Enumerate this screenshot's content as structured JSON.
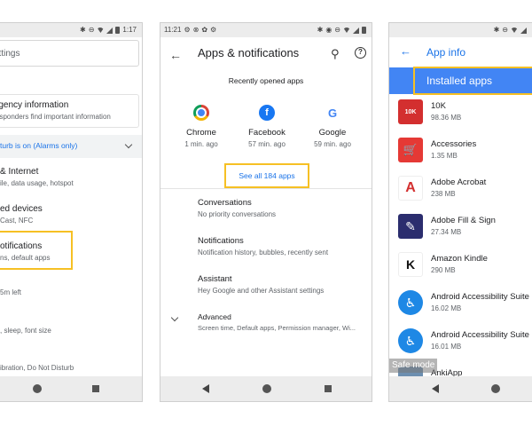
{
  "colors": {
    "accent": "#1a73e8",
    "highlight": "#f6c024",
    "banner": "#4285f4"
  },
  "phone1": {
    "search_placeholder": "ettings",
    "emergency": {
      "title": "rgency information",
      "subtitle": "esponders find important information"
    },
    "dnd_text": "turb is on (Alarms only)",
    "items": [
      {
        "title": "& Internet",
        "subtitle": "ile, data usage, hotspot"
      },
      {
        "title": "ed devices",
        "subtitle": "Cast, NFC"
      },
      {
        "title": "otifications",
        "subtitle": "ns, default apps"
      },
      {
        "title": "",
        "subtitle": "5m left"
      },
      {
        "title": "",
        "subtitle": ", sleep, font size"
      },
      {
        "title": "",
        "subtitle": "ibration, Do Not Disturb"
      }
    ],
    "status_time": "1:17"
  },
  "phone2": {
    "status_time": "11:21",
    "title": "Apps & notifications",
    "recent_title": "Recently opened apps",
    "apps": [
      {
        "name": "Chrome",
        "time": "1 min. ago",
        "icon": "chrome-icon"
      },
      {
        "name": "Facebook",
        "time": "57 min. ago",
        "icon": "facebook-icon",
        "glyph": "f"
      },
      {
        "name": "Google",
        "time": "59 min. ago",
        "icon": "google-icon",
        "glyph": "G"
      }
    ],
    "see_all": "See all 184 apps",
    "items": [
      {
        "title": "Conversations",
        "subtitle": "No priority conversations"
      },
      {
        "title": "Notifications",
        "subtitle": "Notification history, bubbles, recently sent"
      },
      {
        "title": "Assistant",
        "subtitle": "Hey Google and other Assistant settings"
      },
      {
        "title": "Advanced",
        "subtitle": "Screen time, Default apps, Permission manager, Wi..."
      }
    ]
  },
  "phone3": {
    "title": "App info",
    "banner": "Installed apps",
    "apps": [
      {
        "name": "10K",
        "size": "98.36 MB",
        "color": "#d32f2f",
        "glyph": "10K"
      },
      {
        "name": "Accessories",
        "size": "1.35 MB",
        "color": "#e53935",
        "glyph": "🛒"
      },
      {
        "name": "Adobe Acrobat",
        "size": "238 MB",
        "color": "#ffffff",
        "glyph": "A"
      },
      {
        "name": "Adobe Fill & Sign",
        "size": "27.34 MB",
        "color": "#2b2d6e",
        "glyph": "✎"
      },
      {
        "name": "Amazon Kindle",
        "size": "290 MB",
        "color": "#ffffff",
        "glyph": "K"
      },
      {
        "name": "Android Accessibility Suite",
        "size": "16.02 MB",
        "color": "#1e88e5",
        "glyph": "♿"
      },
      {
        "name": "Android Accessibility Suite",
        "size": "16.01 MB",
        "color": "#1e88e5",
        "glyph": "♿"
      },
      {
        "name": "AnkiApp",
        "size": "",
        "color": "#6d8fb0",
        "glyph": ""
      }
    ],
    "safe_mode": "Safe mode"
  }
}
